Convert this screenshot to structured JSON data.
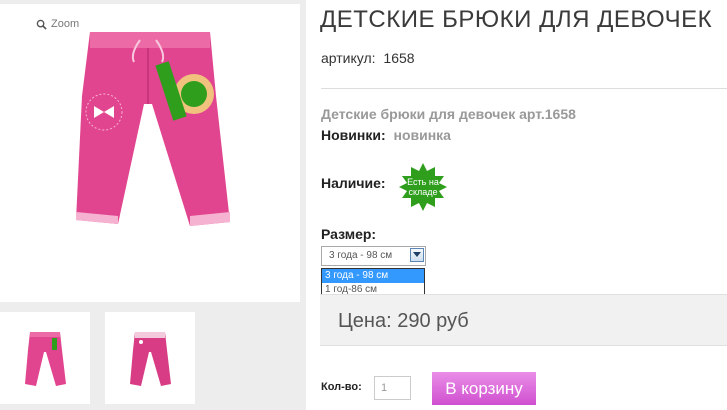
{
  "product": {
    "title": "ДЕТСКИЕ БРЮКИ ДЛЯ ДЕВОЧЕК",
    "sku_label": "артикул:",
    "sku_value": "1658",
    "subtitle": "Детские брюки для девочек арт.1658",
    "novelty_label": "Новинки:",
    "novelty_value": "новинка",
    "availability_label": "Наличие:",
    "stock_badge": "Есть на складе",
    "size_label": "Размер:",
    "size_selected": "3 года - 98 см",
    "size_options": [
      "3 года - 98 см",
      "1 год-86 см"
    ],
    "price": "Цена: 290 руб",
    "qty_label": "Кол-во:",
    "qty_value": "1",
    "cart_button": "В корзину"
  },
  "gallery": {
    "zoom_label": "Zoom",
    "thumbnail_count": 2
  },
  "colors": {
    "product_pink": "#e2458f",
    "badge_green": "#2e9e1c",
    "cart_button": "#d65bd6",
    "selection_blue": "#3399ff"
  },
  "icons": [
    "zoom-icon",
    "dropdown-arrow-icon",
    "stock-badge-icon"
  ]
}
